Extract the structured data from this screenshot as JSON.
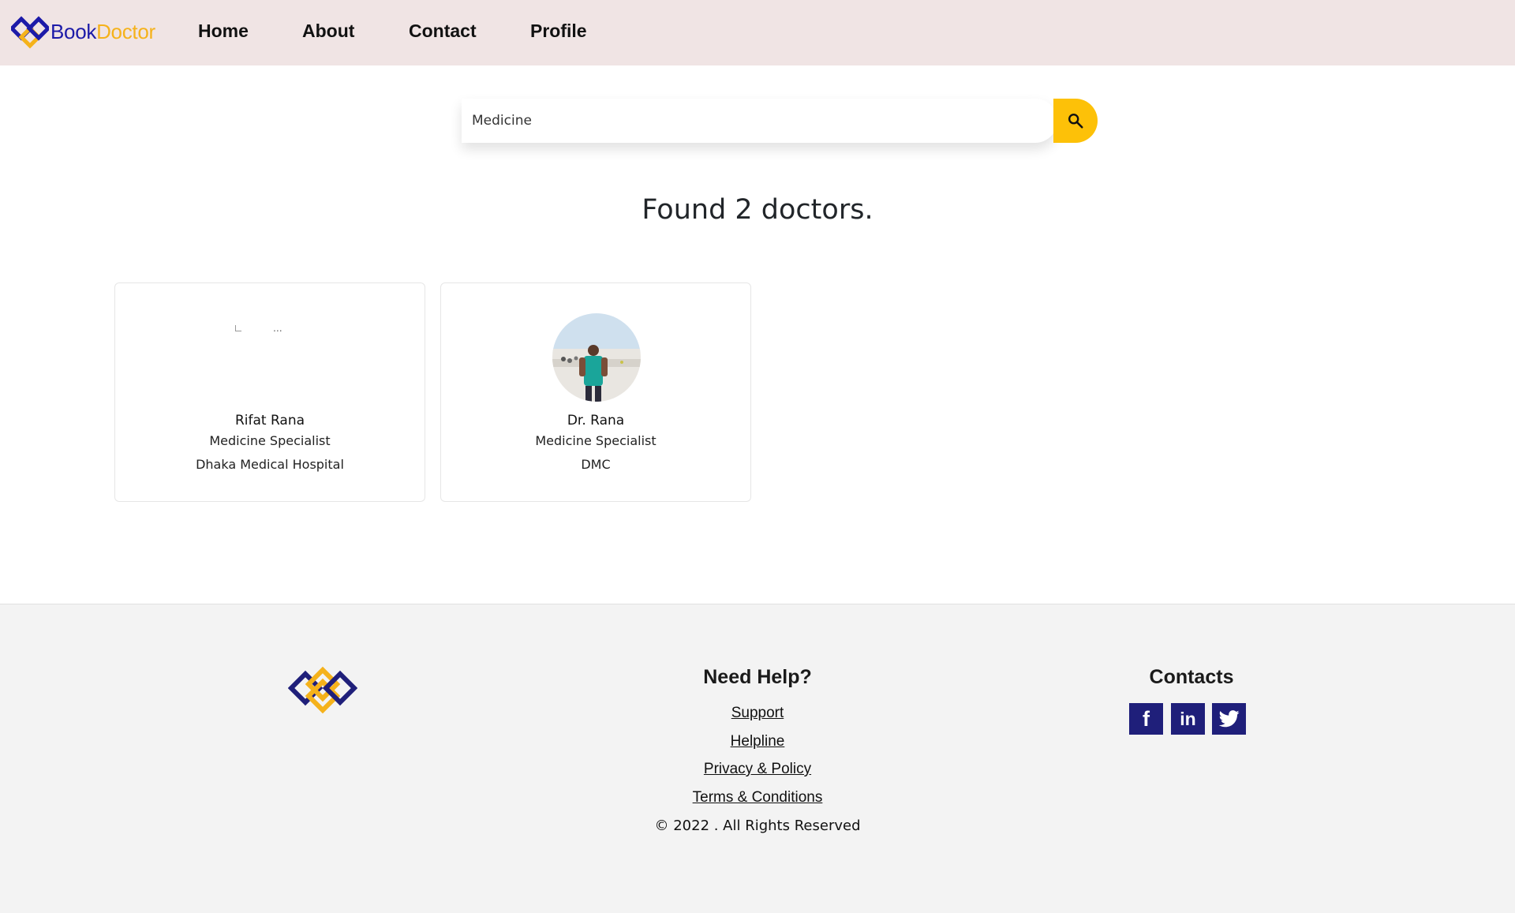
{
  "brand": {
    "part1": "Book",
    "part2": "Doctor"
  },
  "nav": {
    "home": "Home",
    "about": "About",
    "contact": "Contact",
    "profile": "Profile"
  },
  "search": {
    "value": "Medicine"
  },
  "results_heading": "Found 2 doctors.",
  "doctors": [
    {
      "name": "Rifat Rana",
      "specialty": "Medicine Specialist",
      "hospital": "Dhaka Medical Hospital",
      "image_alt": "..."
    },
    {
      "name": "Dr. Rana",
      "specialty": "Medicine Specialist",
      "hospital": "DMC"
    }
  ],
  "footer": {
    "help_title": "Need Help?",
    "links": {
      "support": "Support",
      "helpline": "Helpline",
      "privacy": "Privacy & Policy",
      "terms": "Terms & Conditions"
    },
    "copyright": "© 2022 . All Rights Reserved",
    "contacts_title": "Contacts",
    "social": {
      "facebook": "f",
      "linkedin": "in"
    }
  },
  "colors": {
    "navbar_bg": "#f0e4e4",
    "brand_blue": "#1c1aa8",
    "brand_yellow": "#f5b21b",
    "search_button": "#fdc108",
    "social_bg": "#1f1f7a",
    "footer_bg": "#f3f3f3"
  }
}
